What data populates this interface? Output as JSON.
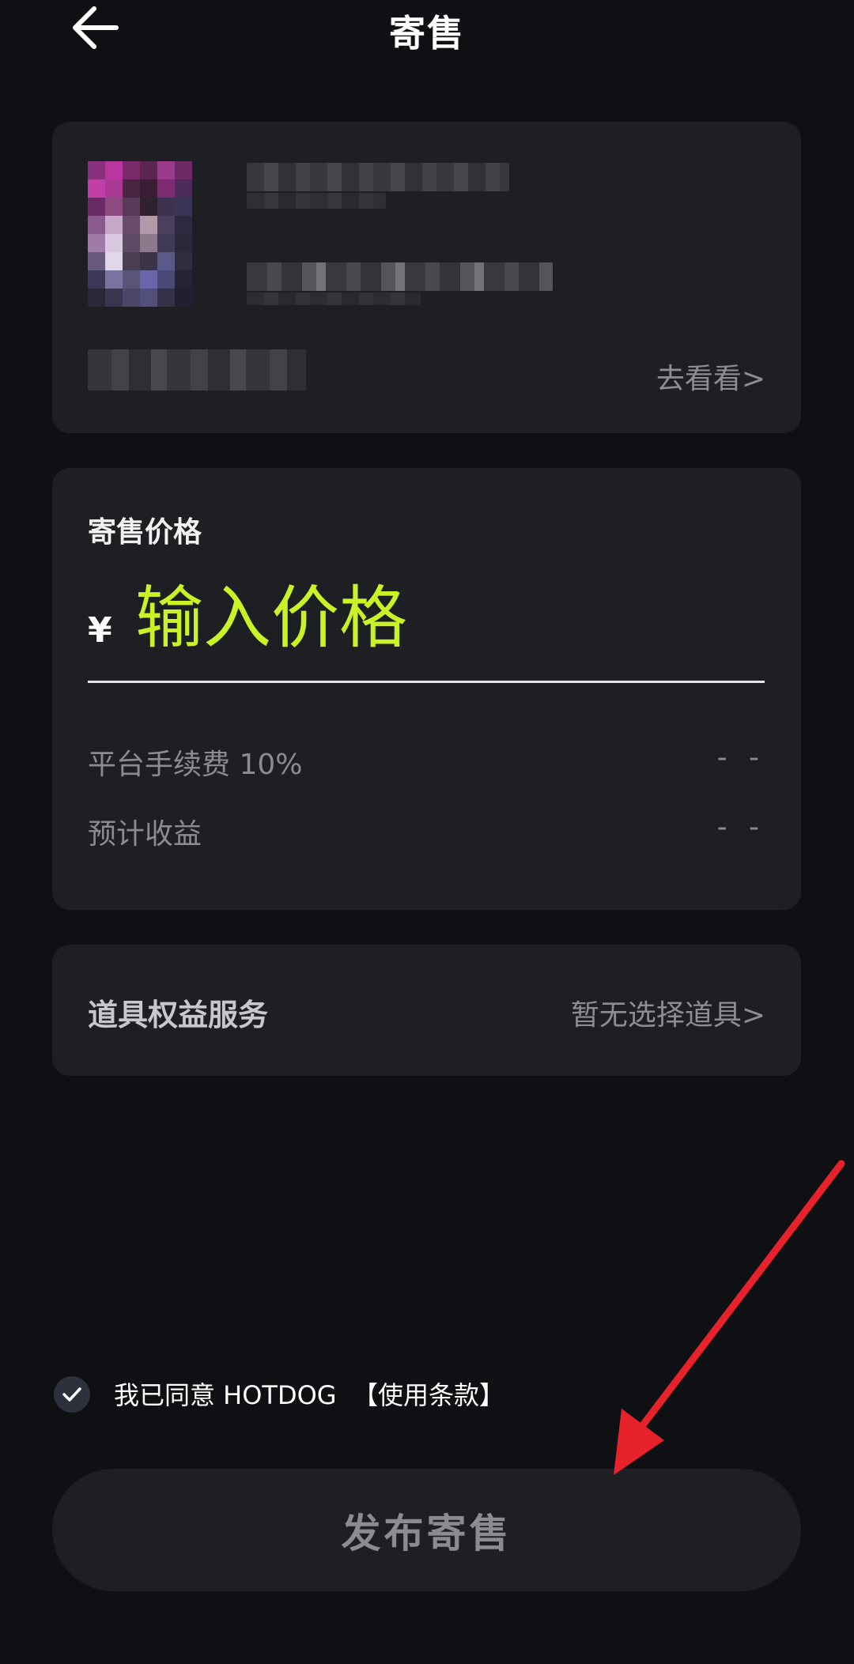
{
  "header": {
    "title": "寄售"
  },
  "product_card": {
    "goto_label": "去看看>"
  },
  "price_card": {
    "label": "寄售价格",
    "currency_symbol": "¥",
    "input_placeholder": "输入价格",
    "input_value": "",
    "fee_label": "平台手续费 10%",
    "fee_value": "- -",
    "income_label": "预计收益",
    "income_value": "- -"
  },
  "service_card": {
    "label": "道具权益服务",
    "value": "暂无选择道具>"
  },
  "agreement": {
    "checked": true,
    "text": "我已同意 HOTDOG",
    "terms_link": "【使用条款】"
  },
  "publish_button": {
    "label": "发布寄售"
  },
  "colors": {
    "background": "#0f1014",
    "card": "#1e1f23",
    "accent": "#c9f227",
    "muted_text": "#8b8c91",
    "annotation_arrow": "#e8222b"
  },
  "icons": {
    "back": "back-arrow-icon",
    "check": "checkmark-icon"
  }
}
